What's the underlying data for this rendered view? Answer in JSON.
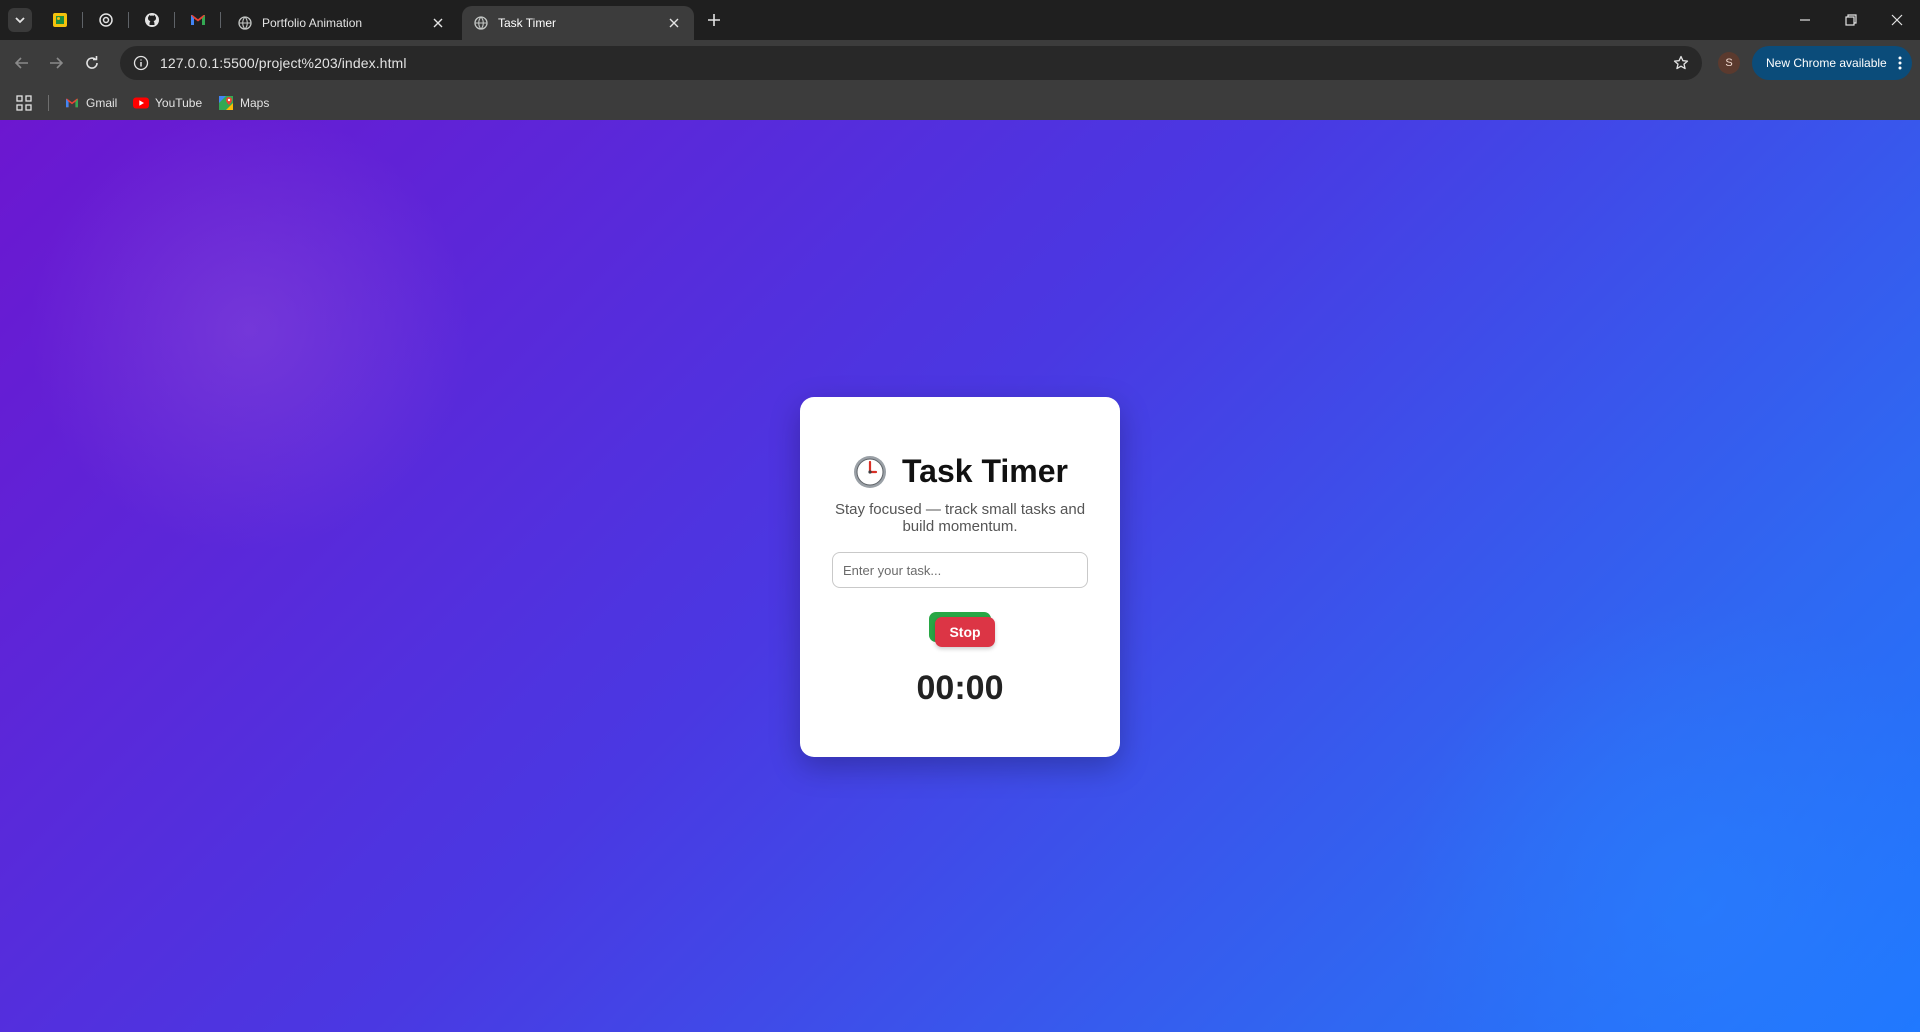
{
  "browser": {
    "tabs": [
      {
        "title": "Portfolio Animation",
        "active": false
      },
      {
        "title": "Task Timer",
        "active": true
      }
    ],
    "address": "127.0.0.1:5500/project%203/index.html",
    "avatar_letter": "S",
    "update_chip": "New Chrome available",
    "bookmarks": [
      {
        "label": "Gmail",
        "icon": "gmail-icon"
      },
      {
        "label": "YouTube",
        "icon": "youtube-icon"
      },
      {
        "label": "Maps",
        "icon": "maps-icon"
      }
    ]
  },
  "app": {
    "title": "Task Timer",
    "title_icon": "clock-icon",
    "subtitle": "Stay focused — track small tasks and build momentum.",
    "task_placeholder": "Enter your task...",
    "stop_label": "Stop",
    "timer": "00:00",
    "colors": {
      "start_button": "#28a745",
      "stop_button": "#dc3545",
      "gradient_start": "#6c17d0",
      "gradient_end": "#1f78ff"
    }
  }
}
